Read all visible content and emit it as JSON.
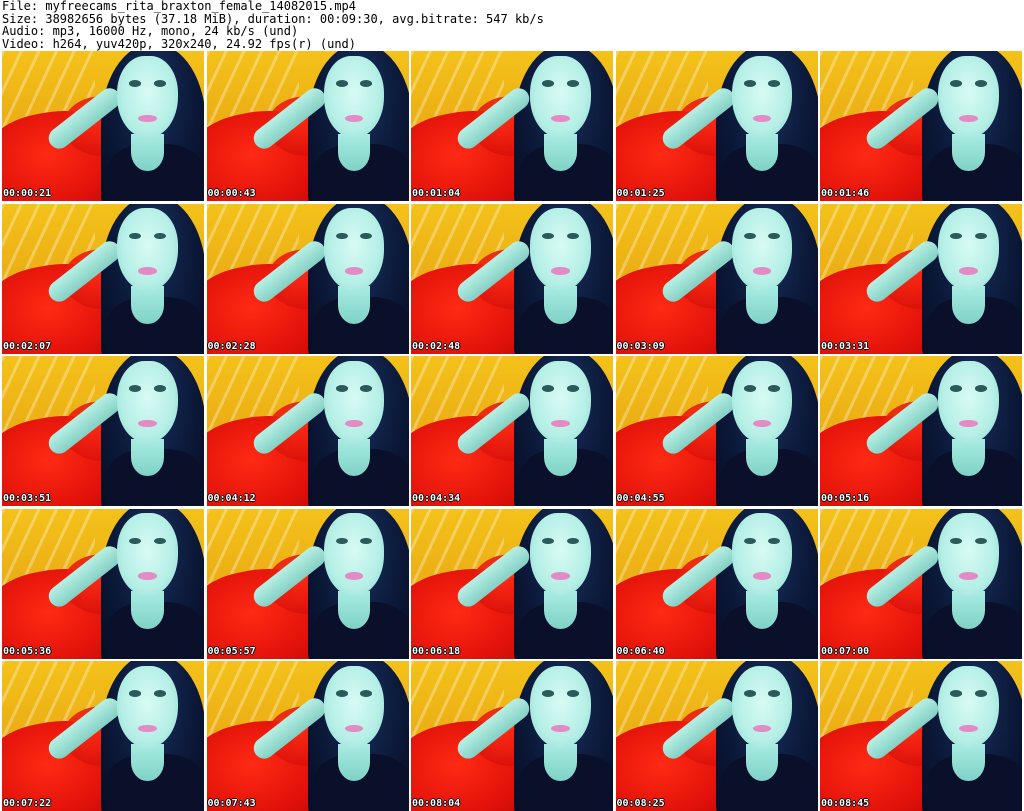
{
  "header": {
    "file": "File: myfreecams_rita_braxton_female_14082015.mp4",
    "size": "Size: 38982656 bytes (37.18 MiB), duration: 00:09:30, avg.bitrate: 547 kb/s",
    "audio": "Audio: mp3, 16000 Hz, mono, 24 kb/s (und)",
    "video": "Video: h264, yuv420p, 320x240, 24.92 fps(r) (und)"
  },
  "thumbnails": [
    "00:00:21",
    "00:00:43",
    "00:01:04",
    "00:01:25",
    "00:01:46",
    "00:02:07",
    "00:02:28",
    "00:02:48",
    "00:03:09",
    "00:03:31",
    "00:03:51",
    "00:04:12",
    "00:04:34",
    "00:04:55",
    "00:05:16",
    "00:05:36",
    "00:05:57",
    "00:06:18",
    "00:06:40",
    "00:07:00",
    "00:07:22",
    "00:07:43",
    "00:08:04",
    "00:08:25",
    "00:08:45"
  ]
}
